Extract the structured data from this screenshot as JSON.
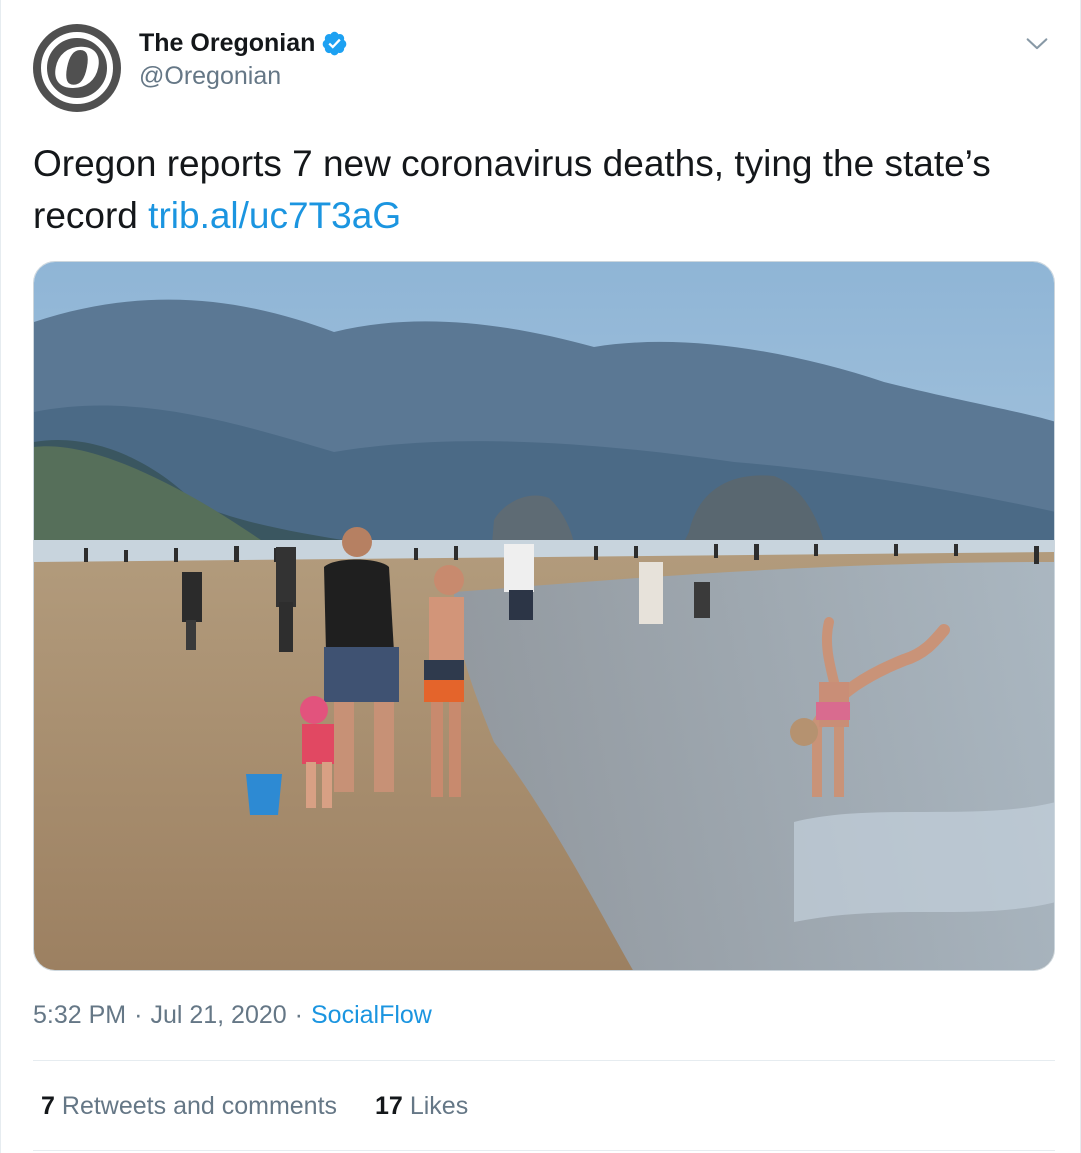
{
  "author": {
    "display_name": "The Oregonian",
    "handle": "@Oregonian",
    "avatar_letter": "O",
    "verified": true
  },
  "tweet": {
    "text": "Oregon reports 7 new coronavirus deaths, tying the state’s record",
    "link": "trib.al/uc7T3aG",
    "time": "5:32 PM",
    "date": "Jul 21, 2020",
    "separator": "·",
    "source": "SocialFlow"
  },
  "stats": {
    "retweets_count": "7",
    "retweets_label": "Retweets and comments",
    "likes_count": "17",
    "likes_label": "Likes"
  },
  "colors": {
    "link": "#1b95e0",
    "verified": "#1da1f2",
    "secondary_text": "#657786"
  },
  "icons": {
    "verified": "verified-badge-icon",
    "menu": "chevron-down-icon"
  }
}
